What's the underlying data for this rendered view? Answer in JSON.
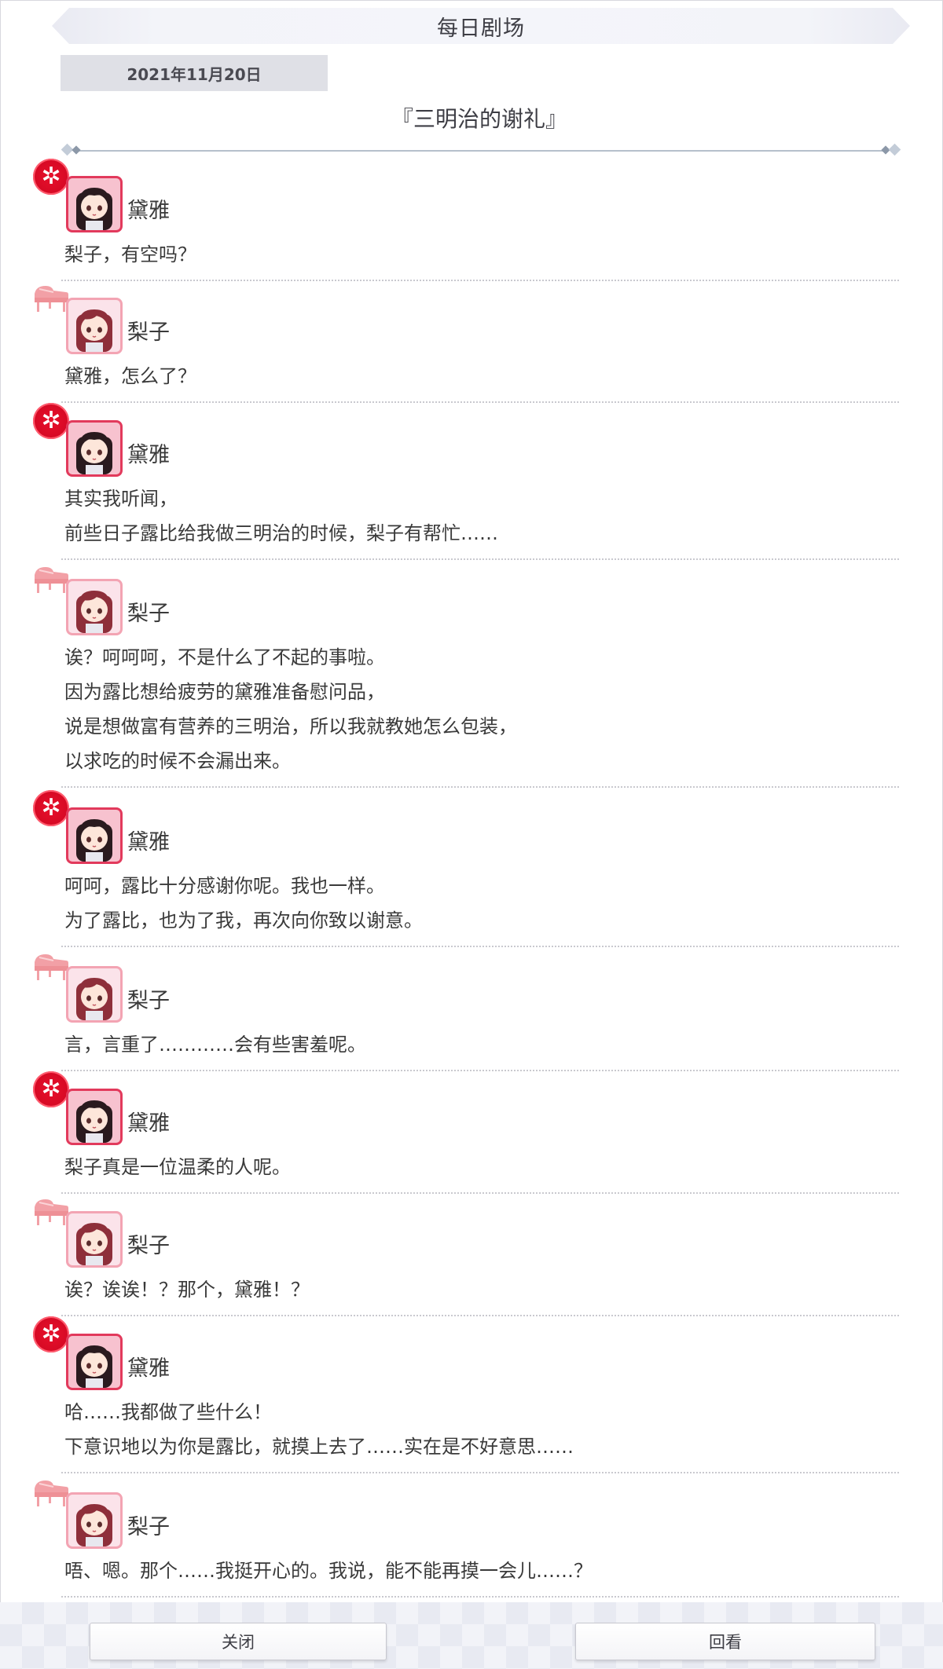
{
  "header": {
    "title": "每日剧场"
  },
  "date": "2021年11月20日",
  "story_title": "『三明治的谢礼』",
  "characters": {
    "daia": {
      "name": "黛雅",
      "icon": "red-flower-icon",
      "accent": "#e23a5c"
    },
    "riko": {
      "name": "梨子",
      "icon": "piano-icon",
      "accent": "#f3a4b3"
    }
  },
  "dialogues": [
    {
      "speaker": "黛雅",
      "lines": [
        "梨子，有空吗？"
      ]
    },
    {
      "speaker": "梨子",
      "lines": [
        "黛雅，怎么了？"
      ]
    },
    {
      "speaker": "黛雅",
      "lines": [
        "其实我听闻，",
        "前些日子露比给我做三明治的时候，梨子有帮忙……"
      ]
    },
    {
      "speaker": "梨子",
      "lines": [
        "诶？呵呵呵，不是什么了不起的事啦。",
        "因为露比想给疲劳的黛雅准备慰问品，",
        "说是想做富有营养的三明治，所以我就教她怎么包装，",
        "以求吃的时候不会漏出来。"
      ]
    },
    {
      "speaker": "黛雅",
      "lines": [
        "呵呵，露比十分感谢你呢。我也一样。",
        "为了露比，也为了我，再次向你致以谢意。"
      ]
    },
    {
      "speaker": "梨子",
      "lines": [
        "言，言重了…………会有些害羞呢。"
      ]
    },
    {
      "speaker": "黛雅",
      "lines": [
        "梨子真是一位温柔的人呢。"
      ]
    },
    {
      "speaker": "梨子",
      "lines": [
        "诶？诶诶！？那个，黛雅！？"
      ]
    },
    {
      "speaker": "黛雅",
      "lines": [
        "哈……我都做了些什么！",
        "下意识地以为你是露比，就摸上去了……实在是不好意思……"
      ]
    },
    {
      "speaker": "梨子",
      "lines": [
        "唔、嗯。那个……我挺开心的。我说，能不能再摸一会儿……？"
      ]
    }
  ],
  "footer": {
    "close_label": "关闭",
    "replay_label": "回看"
  }
}
